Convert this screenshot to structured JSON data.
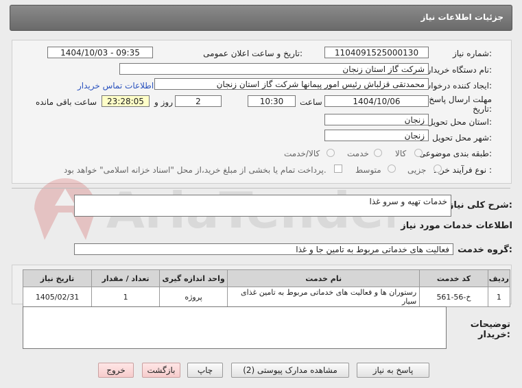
{
  "header": {
    "title": "جزئیات اطلاعات نیاز"
  },
  "form": {
    "need_number_label": "شماره نیاز:",
    "need_number": "1104091525000130",
    "announce_label": "تاریخ و ساعت اعلان عمومی:",
    "announce_value": "1404/10/03 - 09:35",
    "buyer_org_label": "نام دستگاه خریدار:",
    "buyer_org": "شرکت گاز استان زنجان",
    "creator_label": "ایجاد کننده درخواست:",
    "creator": "محمدتقی قزلباش رئیس امور پیمانها شرکت گاز استان زنجان",
    "contact_link": "اطلاعات تماس خریدار",
    "deadline_label": "مهلت ارسال پاسخ: تا",
    "deadline_label2": "تاریخ:",
    "deadline_date": "1404/10/06",
    "time_label": "ساعت",
    "deadline_time": "10:30",
    "days_value": "2",
    "days_label": "روز و",
    "remaining_time": "23:28:05",
    "remaining_label": "ساعت باقی مانده",
    "province_label": "استان محل تحویل:",
    "province": "زنجان",
    "city_label": "شهر محل تحویل:",
    "city": "زنجان",
    "category_label": "طبقه بندی موضوعی:",
    "category_options": [
      "کالا",
      "خدمت",
      "کالا/خدمت"
    ],
    "process_label": "نوع فرآیند خرید :",
    "process_options": [
      "جزیی",
      "متوسط"
    ],
    "payment_note": "پرداخت تمام یا بخشی از مبلغ خرید،از محل \"اسناد خزانه اسلامی\" خواهد بود."
  },
  "summary": {
    "label": "شرح کلی نیاز:",
    "value": "خدمات تهیه و سرو غذا"
  },
  "services": {
    "section_title": "اطلاعات خدمات مورد نیاز",
    "group_label": "گروه خدمت:",
    "group_value": "فعالیت های خدماتی مربوط به تامین جا و غذا",
    "columns": [
      "ردیف",
      "کد خدمت",
      "نام خدمت",
      "واحد اندازه گیری",
      "تعداد / مقدار",
      "تاریخ نیاز"
    ],
    "rows": [
      {
        "row": "1",
        "code": "خ-56-561",
        "name": "رستوران ها و فعالیت های خدماتی مربوط به تامین غذای سیار",
        "unit": "پروژه",
        "qty": "1",
        "date": "1405/02/31"
      }
    ]
  },
  "notes": {
    "label": "توضیحات",
    "label2": "خریدار:"
  },
  "buttons": {
    "reply": "پاسخ به نیاز",
    "attachments": "مشاهده مدارک پیوستی (2)",
    "print": "چاپ",
    "back": "بازگشت",
    "exit": "خروج"
  },
  "watermark": {
    "text": "AriaTender.net"
  },
  "colors": {
    "header": "#7a7a7a",
    "highlight": "#ffffc8",
    "link": "#2a52be",
    "pink_button": "#f6cccc"
  }
}
